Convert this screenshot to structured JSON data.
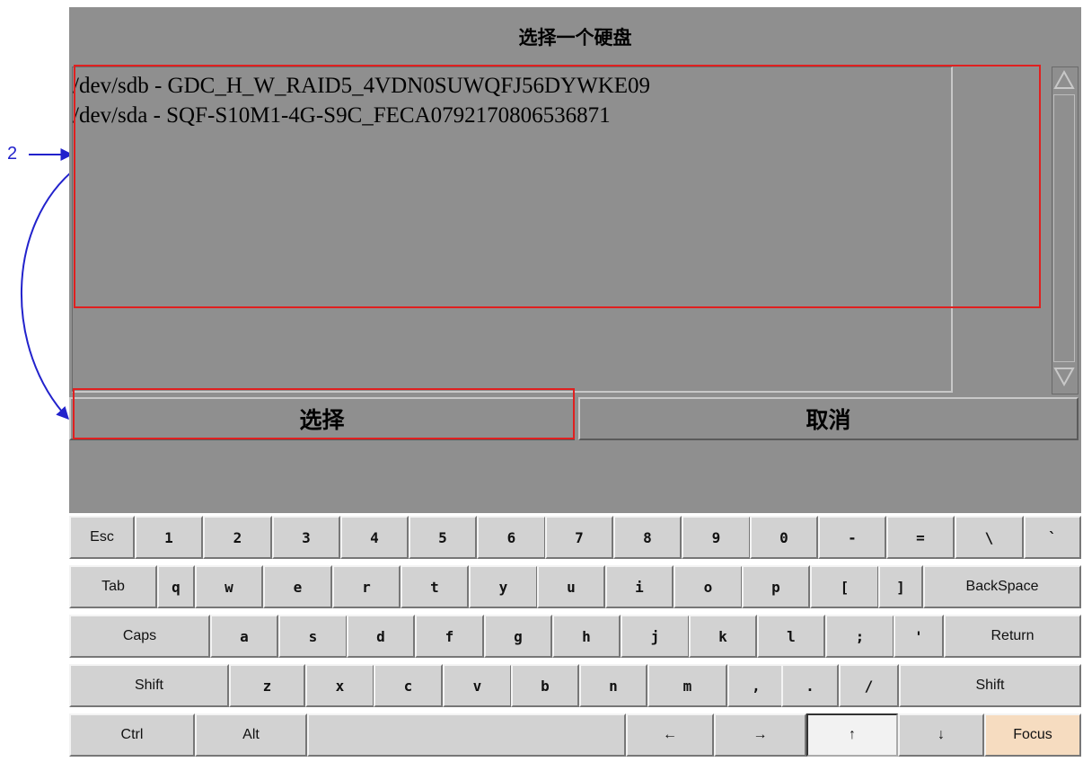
{
  "dialog": {
    "title": "选择一个硬盘",
    "disks": [
      "/dev/sdb - GDC_H_W_RAID5_4VDN0SUWQFJ56DYWKE09",
      "/dev/sda - SQF-S10M1-4G-S9C_FECA0792170806536871"
    ],
    "select_label": "选择",
    "cancel_label": "取消"
  },
  "annotation": {
    "step_number": "2",
    "highlight_color": "#e02020",
    "arrow_color": "#2222cc"
  },
  "keyboard": {
    "rows": [
      [
        "Esc",
        "1",
        "2",
        "3",
        "4",
        "5",
        "6",
        "7",
        "8",
        "9",
        "0",
        "-",
        "=",
        "\\",
        "`"
      ],
      [
        "Tab",
        "q",
        "w",
        "e",
        "r",
        "t",
        "y",
        "u",
        "i",
        "o",
        "p",
        "[",
        "]",
        "BackSpace"
      ],
      [
        "Caps",
        "a",
        "s",
        "d",
        "f",
        "g",
        "h",
        "j",
        "k",
        "l",
        ";",
        "'",
        "Return"
      ],
      [
        "Shift",
        "z",
        "x",
        "c",
        "v",
        "b",
        "n",
        "m",
        ",",
        ".",
        "/",
        "Shift"
      ],
      [
        "Ctrl",
        "Alt",
        "",
        "←",
        "→",
        "↑",
        "↓",
        "Focus"
      ]
    ]
  },
  "colors": {
    "background": "#8f8f8f",
    "key": "#d2d2d2",
    "focus_key": "#f6dcc0"
  }
}
